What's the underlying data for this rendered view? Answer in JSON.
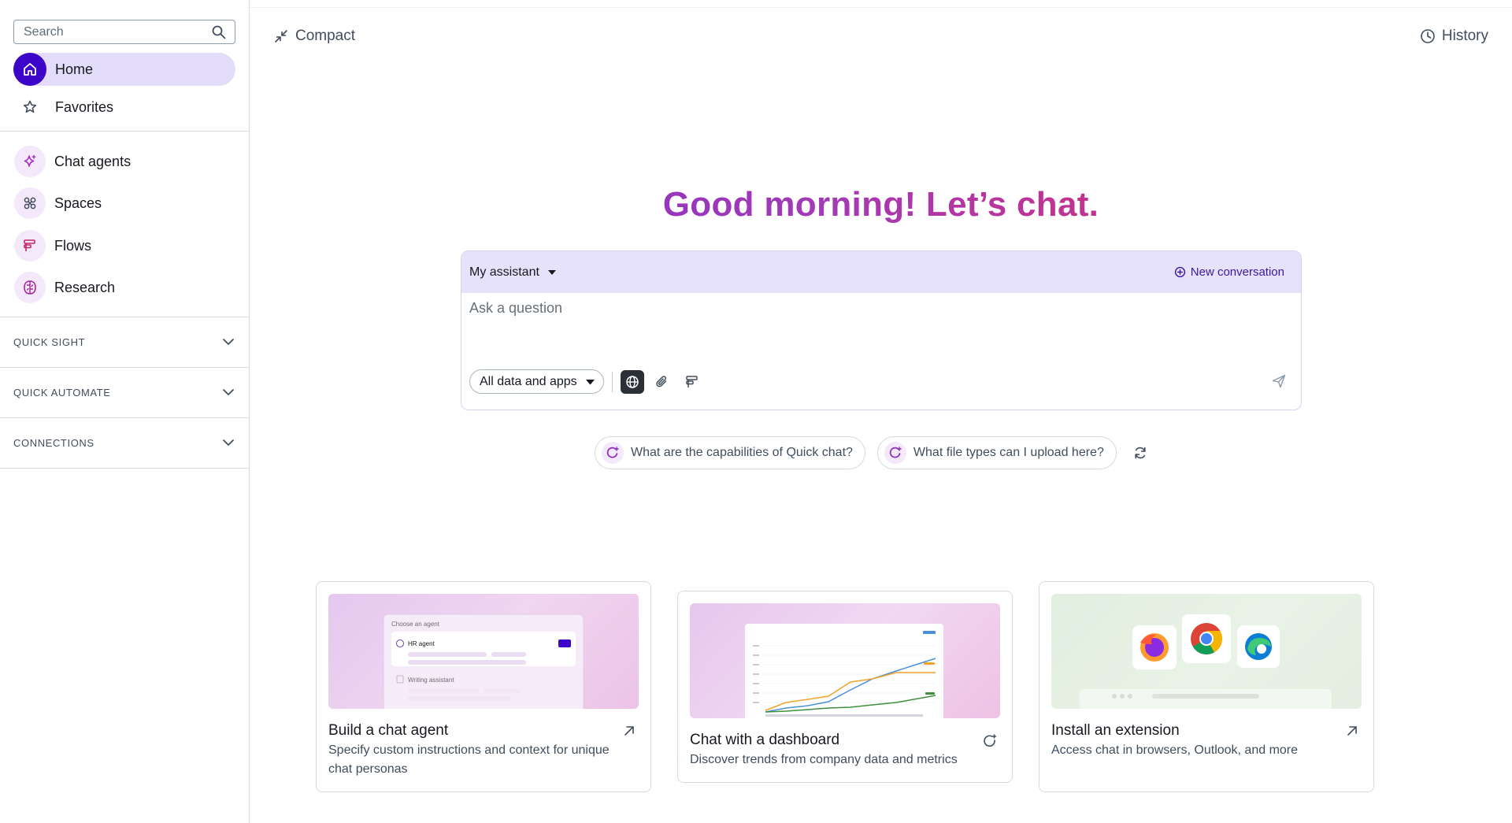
{
  "sidebar": {
    "search": {
      "placeholder": "Search"
    },
    "nav": {
      "home": "Home",
      "favorites": "Favorites",
      "chat_agents": "Chat agents",
      "spaces": "Spaces",
      "flows": "Flows",
      "research": "Research"
    },
    "sections": {
      "quick_sight": "QUICK SIGHT",
      "quick_automate": "QUICK AUTOMATE",
      "connections": "CONNECTIONS"
    }
  },
  "header": {
    "compact": "Compact",
    "history": "History"
  },
  "main": {
    "greeting": "Good morning! Let’s chat.",
    "composer": {
      "assistant": "My assistant",
      "new_conversation": "New conversation",
      "placeholder": "Ask a question",
      "scope": "All data and apps"
    },
    "suggestions": [
      "What are the capabilities of Quick chat?",
      "What file types can I upload here?"
    ],
    "cards": [
      {
        "title": "Build a chat agent",
        "desc": "Specify custom instructions and context for unique chat personas",
        "preview": {
          "heading": "Choose an agent",
          "item1": "HR agent",
          "item2": "Writing assistant"
        }
      },
      {
        "title": "Chat with a dashboard",
        "desc": "Discover trends from company data and metrics"
      },
      {
        "title": "Install an extension",
        "desc": "Access chat in browsers, Outlook, and more"
      }
    ]
  },
  "colors": {
    "accent": "#3d05c8",
    "active_bg": "#e3dcfb",
    "composer_head": "#e6e2fb",
    "link": "#3d16a3"
  }
}
